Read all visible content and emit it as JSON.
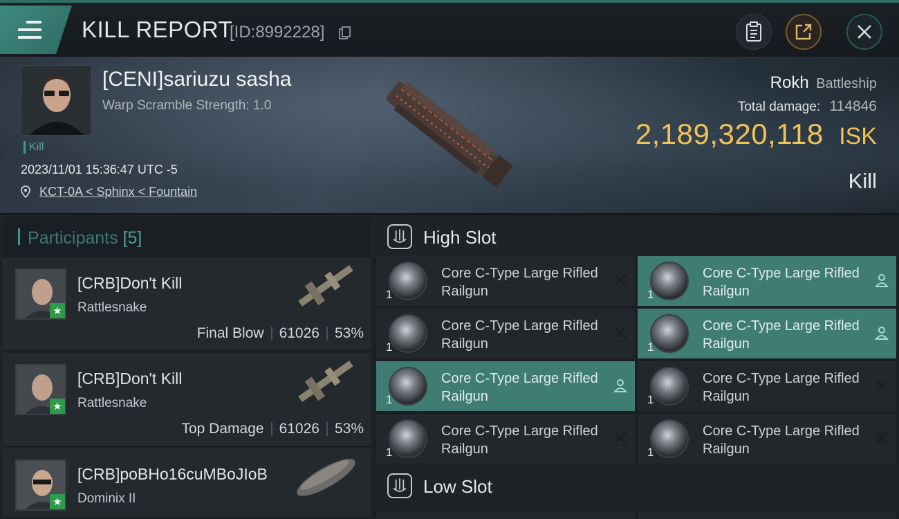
{
  "header": {
    "title": "KILL REPORT",
    "report_id": "[ID:8992228]",
    "buttons": {
      "copy": "copy-icon",
      "clipboard": "clipboard-icon",
      "share": "share-icon",
      "close": "close-icon"
    }
  },
  "victim": {
    "name": "[CENI]sariuzu sasha",
    "warp_scramble": "Warp Scramble Strength: 1.0",
    "kill_tag": "Kill",
    "datetime": "2023/11/01 15:36:47 UTC -5",
    "location": "KCT-0A < Sphinx < Fountain",
    "ship_name": "Rokh",
    "ship_class": "Battleship",
    "total_damage_label": "Total damage:",
    "total_damage": "114846",
    "isk_value": "2,189,320,118",
    "isk_unit": "ISK",
    "result": "Kill"
  },
  "participants": {
    "title": "Participants",
    "count": "[5]",
    "items": [
      {
        "name": "[CRB]Don't Kill",
        "ship": "Rattlesnake",
        "role": "Final Blow",
        "damage": "61026",
        "percent": "53%"
      },
      {
        "name": "[CRB]Don't Kill",
        "ship": "Rattlesnake",
        "role": "Top Damage",
        "damage": "61026",
        "percent": "53%"
      },
      {
        "name": "[CRB]poBHo16cuMBoJIoB",
        "ship": "Dominix II"
      }
    ]
  },
  "slots": {
    "high": {
      "title": "High Slot",
      "modules": [
        {
          "name": "Core C-Type Large Rifled Railgun",
          "qty": "1",
          "status": "destroyed",
          "highlight": false
        },
        {
          "name": "Core C-Type Large Rifled Railgun",
          "qty": "1",
          "status": "dropped",
          "highlight": true
        },
        {
          "name": "Core C-Type Large Rifled Railgun",
          "qty": "1",
          "status": "destroyed",
          "highlight": false
        },
        {
          "name": "Core C-Type Large Rifled Railgun",
          "qty": "1",
          "status": "dropped",
          "highlight": true
        },
        {
          "name": "Core C-Type Large Rifled Railgun",
          "qty": "1",
          "status": "dropped",
          "highlight": true
        },
        {
          "name": "Core C-Type Large Rifled Railgun",
          "qty": "1",
          "status": "destroyed",
          "highlight": false
        },
        {
          "name": "Core C-Type Large Rifled Railgun",
          "qty": "1",
          "status": "destroyed",
          "highlight": false
        },
        {
          "name": "Core C-Type Large Rifled Railgun",
          "qty": "1",
          "status": "destroyed",
          "highlight": false
        }
      ]
    },
    "low": {
      "title": "Low Slot"
    }
  },
  "colors": {
    "accent": "#3c9a8a",
    "isk": "#f1c25a",
    "highlight_row": "#3e7c74"
  }
}
